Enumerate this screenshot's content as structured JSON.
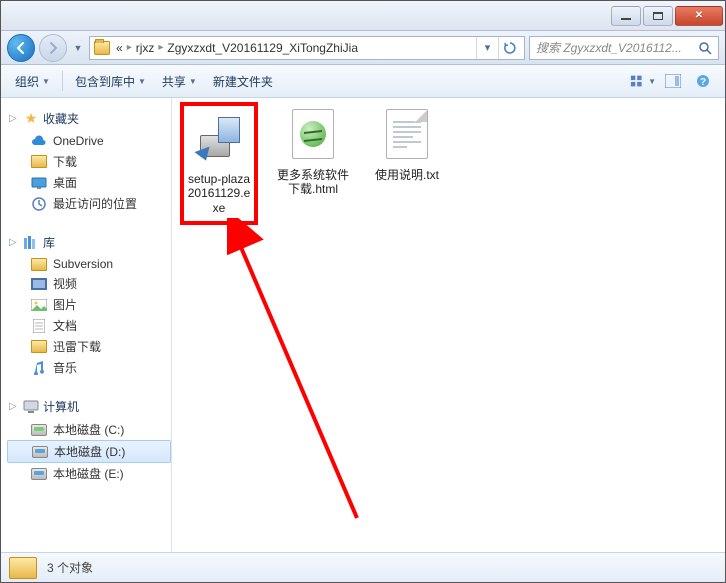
{
  "breadcrumb": {
    "prefix": "«",
    "part1": "rjxz",
    "part2": "Zgyxzxdt_V20161129_XiTongZhiJia"
  },
  "search": {
    "placeholder": "搜索 Zgyxzxdt_V2016112..."
  },
  "toolbar": {
    "organize": "组织",
    "include": "包含到库中",
    "share": "共享",
    "newfolder": "新建文件夹"
  },
  "sidebar": {
    "favorites": {
      "label": "收藏夹",
      "items": [
        "OneDrive",
        "下载",
        "桌面",
        "最近访问的位置"
      ]
    },
    "libraries": {
      "label": "库",
      "items": [
        "Subversion",
        "视频",
        "图片",
        "文档",
        "迅雷下载",
        "音乐"
      ]
    },
    "computer": {
      "label": "计算机",
      "items": [
        "本地磁盘 (C:)",
        "本地磁盘 (D:)",
        "本地磁盘 (E:)"
      ]
    }
  },
  "files": [
    {
      "name": "setup-plaza20161129.exe",
      "type": "exe"
    },
    {
      "name": "更多系统软件下载.html",
      "type": "html"
    },
    {
      "name": "使用说明.txt",
      "type": "txt"
    }
  ],
  "status": {
    "count": "3 个对象"
  }
}
